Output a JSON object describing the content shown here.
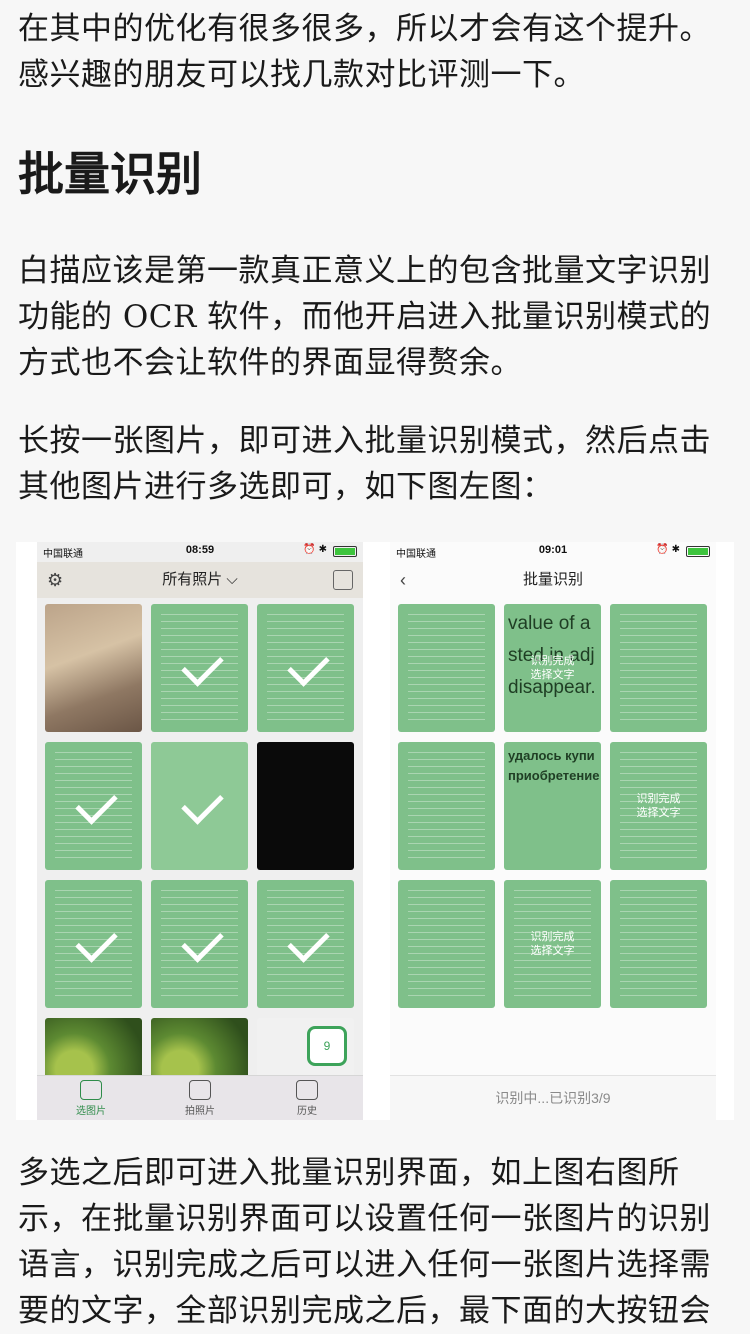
{
  "article": {
    "p1": "在其中的优化有很多很多，所以才会有这个提升。感兴趣的朋友可以找几款对比评测一下。",
    "heading": "批量识别",
    "p2": "白描应该是第一款真正意义上的包含批量文字识别功能的 OCR 软件，而他开启进入批量识别模式的方式也不会让软件的界面显得赘余。",
    "p3": "长按一张图片，即可进入批量识别模式，然后点击其他图片进行多选即可，如下图左图：",
    "p4": "多选之后即可进入批量识别界面，如上图右图所示，在批量识别界面可以设置任何一张图片的识别语言，识别完成之后可以进入任何一张图片选择需要的文字，全部识别完成之后，最下面的大按钮会"
  },
  "left_phone": {
    "carrier": "中国联通",
    "time": "08:59",
    "title": "所有照片",
    "tabs": [
      "选图片",
      "拍照片",
      "历史"
    ],
    "selected_badge": "9"
  },
  "right_phone": {
    "carrier": "中国联通",
    "time": "09:01",
    "title": "批量识别",
    "cell_overlay_1": "识别完成",
    "cell_overlay_2": "选择文字",
    "big_text_a": "value of a",
    "big_text_b": "sted in adj",
    "big_text_c": "disappear.",
    "ru_text_a": "удалось купи",
    "ru_text_b": "приобретение отн",
    "status_text": "识别中...已识别3/9"
  },
  "colors": {
    "selection_green": "#7fc08a",
    "accent_green": "#2f8c4a"
  }
}
